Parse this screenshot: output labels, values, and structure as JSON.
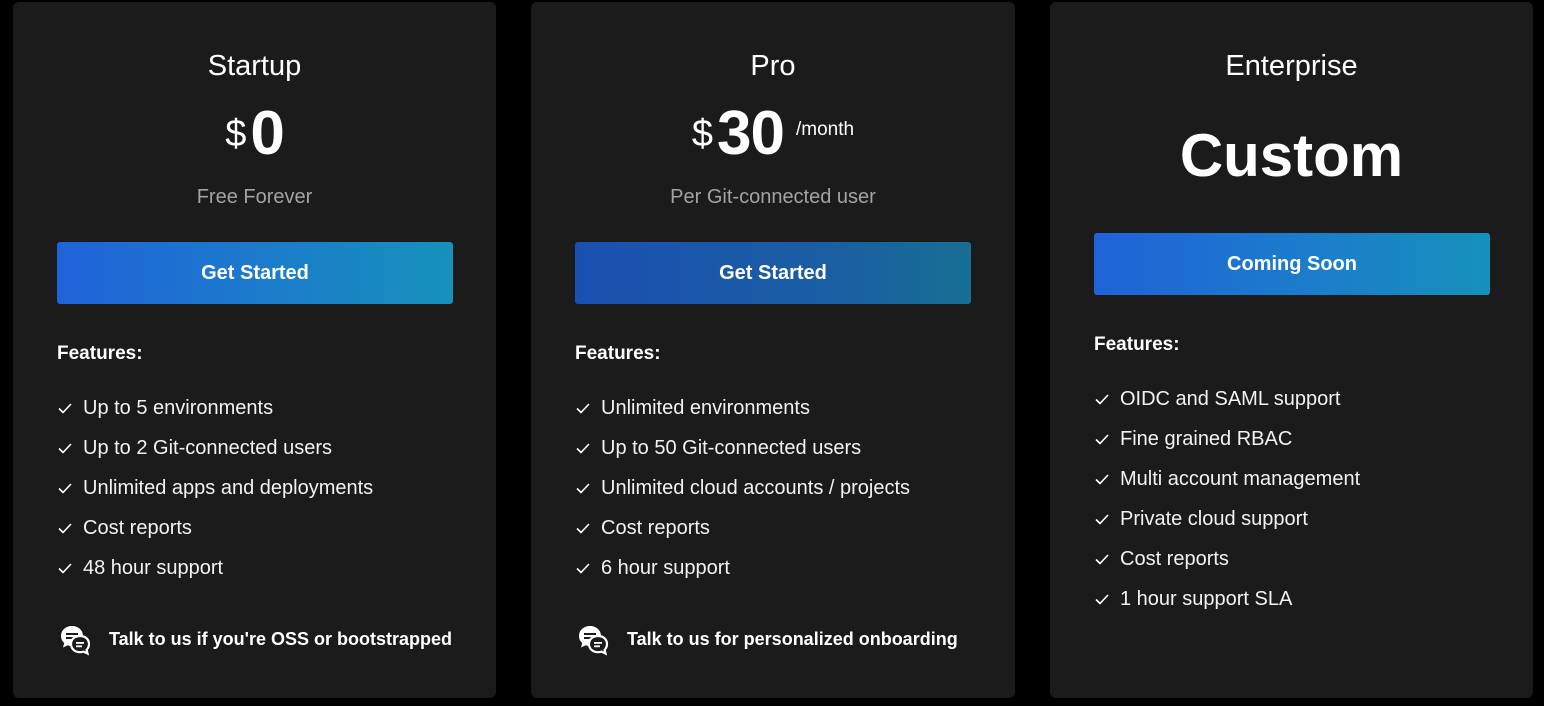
{
  "plans": [
    {
      "name": "Startup",
      "currency": "$",
      "amount": "0",
      "period": "",
      "subtitle": "Free Forever",
      "cta": "Get Started",
      "features_title": "Features:",
      "features": [
        "Up to 5 environments",
        "Up to 2 Git-connected users",
        "Unlimited apps and deployments",
        "Cost reports",
        "48 hour support"
      ],
      "footer": "Talk to us if you're OSS or bootstrapped"
    },
    {
      "name": "Pro",
      "currency": "$",
      "amount": "30",
      "period": "/month",
      "subtitle": "Per Git-connected user",
      "cta": "Get Started",
      "features_title": "Features:",
      "features": [
        "Unlimited environments",
        "Up to 50 Git-connected users",
        "Unlimited cloud accounts / projects",
        "Cost reports",
        "6 hour support"
      ],
      "footer": "Talk to us for personalized onboarding"
    },
    {
      "name": "Enterprise",
      "price_text": "Custom",
      "cta": "Coming Soon",
      "features_title": "Features:",
      "features": [
        "OIDC and SAML support",
        "Fine grained RBAC",
        "Multi account management",
        "Private cloud support",
        "Cost reports",
        "1 hour support SLA"
      ]
    }
  ],
  "icons": {
    "check": "check-icon",
    "chat": "chat-bubbles-icon"
  },
  "colors": {
    "page_bg": "#000000",
    "card_bg": "#1b1b1b",
    "cta_gradient_start": "#1f63d9",
    "cta_gradient_end": "#1591bb",
    "subtitle_text": "#a3a3a3"
  }
}
